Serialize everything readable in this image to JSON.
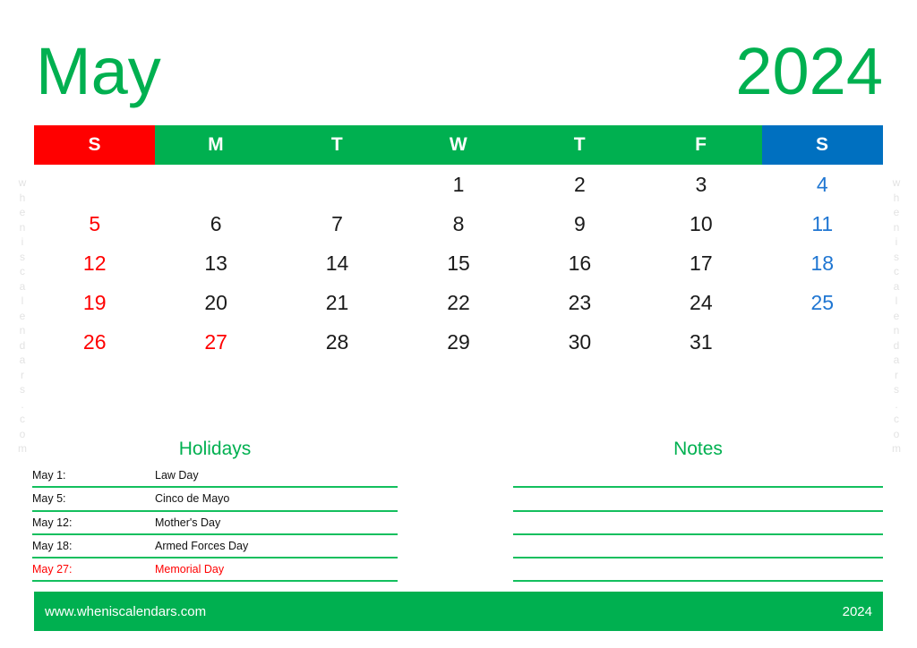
{
  "header": {
    "month": "May",
    "year": "2024"
  },
  "weekdays": [
    {
      "label": "S",
      "kind": "sun"
    },
    {
      "label": "M",
      "kind": "wk"
    },
    {
      "label": "T",
      "kind": "wk"
    },
    {
      "label": "W",
      "kind": "wk"
    },
    {
      "label": "T",
      "kind": "wk"
    },
    {
      "label": "F",
      "kind": "wk"
    },
    {
      "label": "S",
      "kind": "sat"
    }
  ],
  "grid": {
    "weeks": [
      [
        "",
        "",
        "",
        "1",
        "2",
        "3",
        "4"
      ],
      [
        "5",
        "6",
        "7",
        "8",
        "9",
        "10",
        "11"
      ],
      [
        "12",
        "13",
        "14",
        "15",
        "16",
        "17",
        "18"
      ],
      [
        "19",
        "20",
        "21",
        "22",
        "23",
        "24",
        "25"
      ],
      [
        "26",
        "27",
        "28",
        "29",
        "30",
        "31",
        ""
      ]
    ],
    "holiday_dates": [
      "27"
    ]
  },
  "holidays": {
    "title": "Holidays",
    "rows": [
      {
        "date": "May 1:",
        "name": "Law Day",
        "red": false
      },
      {
        "date": "May 5:",
        "name": "Cinco de Mayo",
        "red": false
      },
      {
        "date": "May 12:",
        "name": "Mother's Day",
        "red": false
      },
      {
        "date": "May 18:",
        "name": "Armed Forces Day",
        "red": false
      },
      {
        "date": "May 27:",
        "name": "Memorial Day",
        "red": true
      }
    ]
  },
  "notes": {
    "title": "Notes",
    "line_count": 5
  },
  "watermark": {
    "text": "w\nh\ne\nn\ni\ns\nc\na\nl\ne\nn\nd\na\nr\ns\n.\nc\no\nm"
  },
  "footer": {
    "url": "www.wheniscalendars.com",
    "year": "2024"
  },
  "colors": {
    "green": "#00b050",
    "line_green": "#13bf5e",
    "red": "#ff0000",
    "blue_header": "#0070c0",
    "blue_date": "#1f76d2",
    "text": "#1a1a1a",
    "watermark": "#e3e3e3"
  }
}
